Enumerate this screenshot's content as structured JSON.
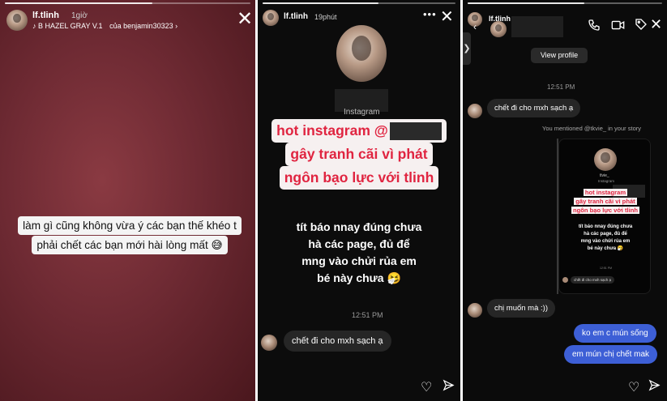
{
  "panel1": {
    "username": "lf.tlinh",
    "time": "1giờ",
    "music": "♪ B HAZEL GRAY V.1",
    "music_by": "của benjamin30323 ›",
    "close_symbol": "✕",
    "caption_line1": "làm gì cũng không vừa ý các bạn thế khéo t",
    "caption_line2": "phải chết các bạn mới hài lòng mất 😅"
  },
  "panel2": {
    "username": "lf.tlinh",
    "time": "19phút",
    "instagram_label": "Instagram",
    "headline_line1": "hot instagram @",
    "headline_line2": "gây tranh cãi vì phát",
    "headline_line3": "ngôn bạo lực với tlinh",
    "sticker_line1": "tít báo nnay đúng chưa",
    "sticker_line2": "hà các page, đủ để",
    "sticker_line3": "mng vào chửi rủa em",
    "sticker_line4": "bé này chưa 🤧",
    "msg_time": "12:51 PM",
    "message": "chết đi cho mxh sạch ạ"
  },
  "panel3": {
    "username": "lf.tlinh",
    "view_profile": "View profile",
    "msg_time": "12:51 PM",
    "message_in1": "chết đi cho mxh sạch ạ",
    "mention": "You mentioned @tkvie_ in your story",
    "mini": {
      "name": "tlvie_",
      "sub": "Instagram",
      "hl1": "hot instagram",
      "hl2": "gây tranh cãi vì phát",
      "hl3": "ngôn bạo lực với tlinh",
      "s1": "tít báo nnay đúng chưa",
      "s2": "hà các page, đủ để",
      "s3": "mng vào chửi rủa em",
      "s4": "bé này chưa 🤧",
      "time": "12:51 PM",
      "msg": "chết đi cho mxh sạch ạ"
    },
    "message_in2": "chị muốn mà :))",
    "message_out1": "ko em c mún sống",
    "message_out2": "em mún chị chết mak"
  }
}
